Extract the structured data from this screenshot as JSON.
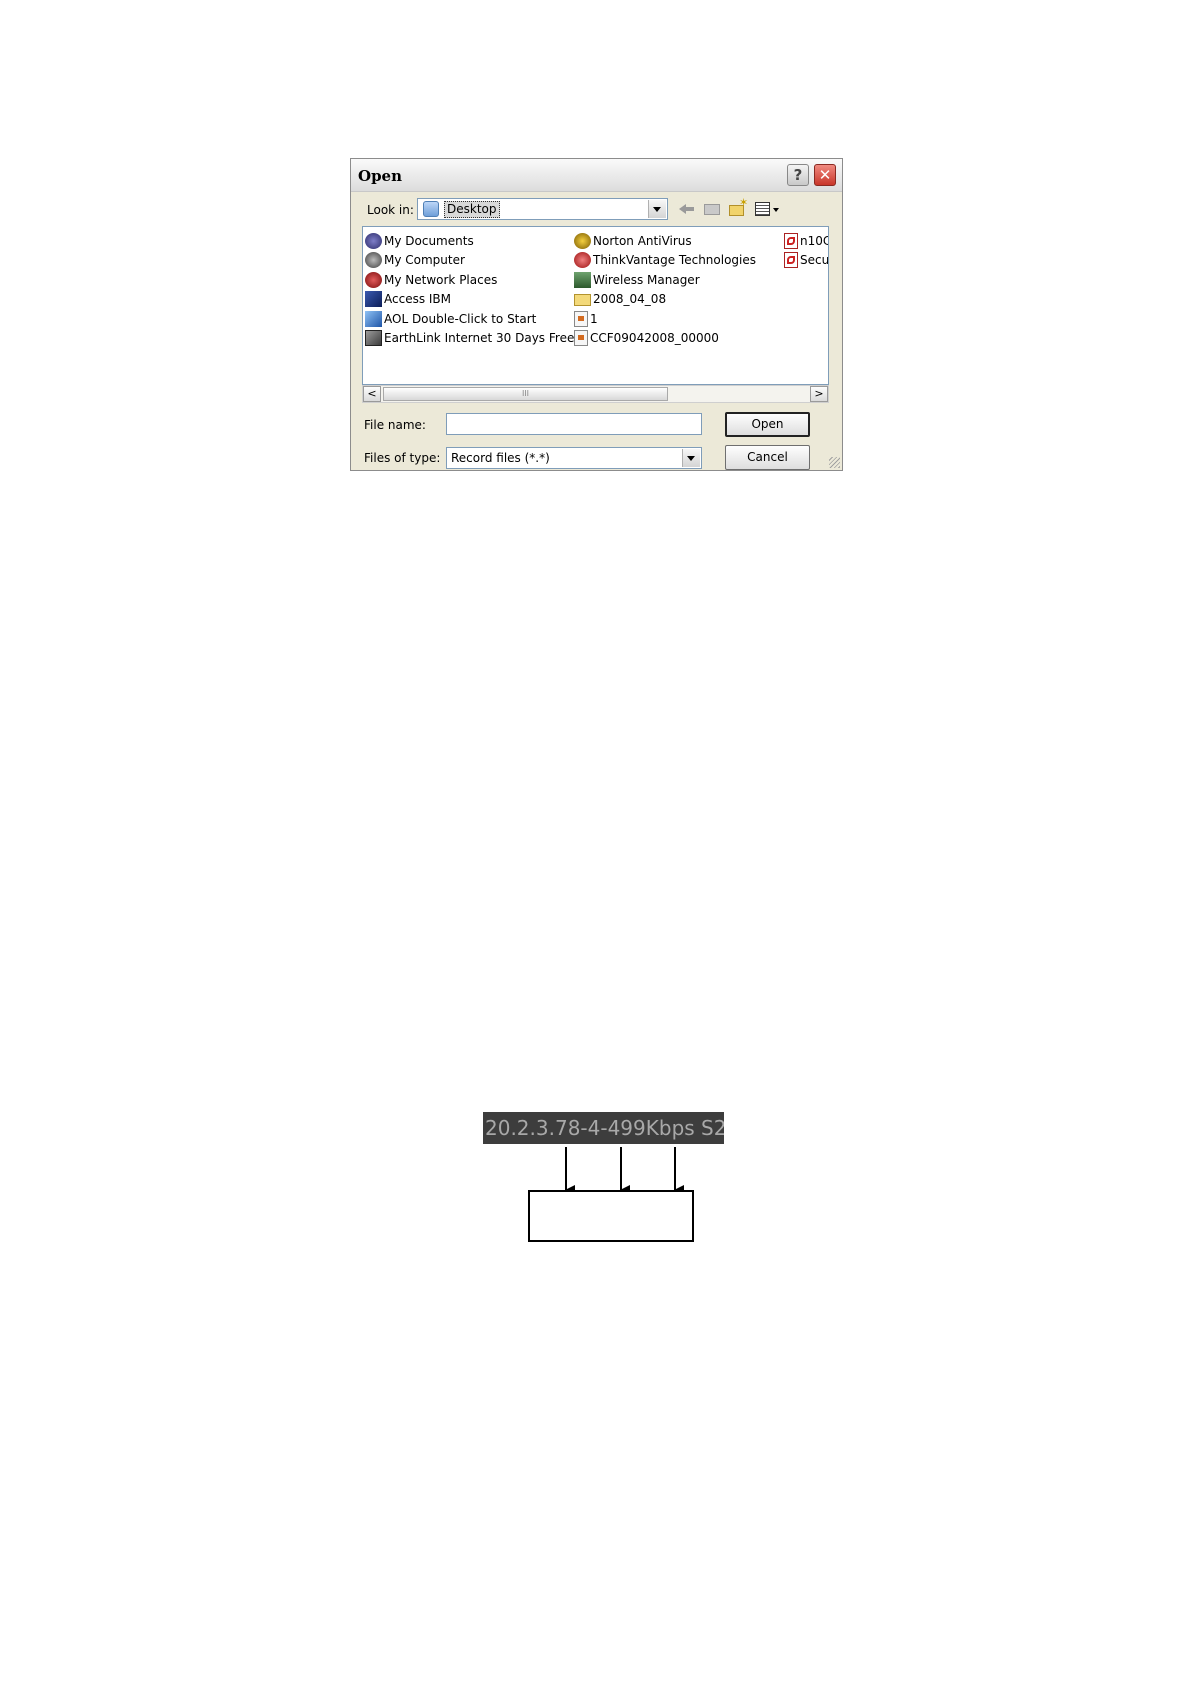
{
  "dialog": {
    "title": "Open",
    "help_symbol": "?",
    "close_symbol": "✕",
    "look_in_label": "Look in:",
    "look_in_value": "Desktop",
    "toolbar_icons": [
      "back-icon",
      "up-folder-icon",
      "new-folder-icon",
      "views-menu-icon"
    ],
    "files": {
      "column1": [
        {
          "name": "My Documents",
          "icon": "my-documents-icon"
        },
        {
          "name": "My Computer",
          "icon": "my-computer-icon"
        },
        {
          "name": "My Network Places",
          "icon": "network-places-icon"
        },
        {
          "name": "Access IBM",
          "icon": "access-ibm-icon"
        },
        {
          "name": "AOL Double-Click to Start",
          "icon": "aol-icon"
        },
        {
          "name": "EarthLink Internet 30 Days Free",
          "icon": "earthlink-icon"
        }
      ],
      "column2": [
        {
          "name": "Norton AntiVirus",
          "icon": "norton-icon"
        },
        {
          "name": "ThinkVantage Technologies",
          "icon": "thinkvantage-icon"
        },
        {
          "name": "Wireless Manager",
          "icon": "wireless-icon"
        },
        {
          "name": "2008_04_08",
          "icon": "folder-icon"
        },
        {
          "name": "1",
          "icon": "file-icon"
        },
        {
          "name": "CCF09042008_00000",
          "icon": "file-icon"
        }
      ],
      "column3": [
        {
          "name": "n10C",
          "icon": "pdf-icon"
        },
        {
          "name": "Secu",
          "icon": "pdf-icon"
        }
      ]
    },
    "scroll_left": "<",
    "scroll_right": ">",
    "scroll_thumb_grip": "III",
    "file_name_label": "File name:",
    "file_name_value": "",
    "files_of_type_label": "Files of type:",
    "files_of_type_value": "Record files (*.*)",
    "open_button": "Open",
    "cancel_button": "Cancel"
  },
  "bitrate_display": {
    "text": "20.2.3.78-4-499Kbps S2"
  },
  "annotation_box": {
    "text": ""
  }
}
